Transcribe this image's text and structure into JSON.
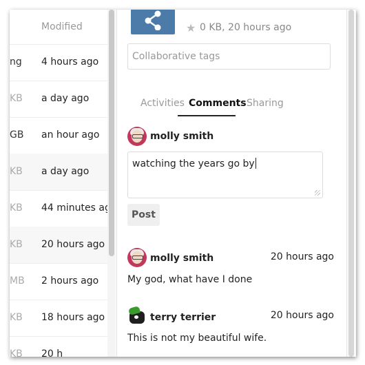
{
  "file_list": {
    "column_modified": "Modified",
    "rows": [
      {
        "size": "ng",
        "modified": "4 hours ago",
        "dark": true,
        "highlight": false
      },
      {
        "size": "KB",
        "modified": "a day ago",
        "dark": false,
        "highlight": false
      },
      {
        "size": "GB",
        "modified": "an hour ago",
        "dark": true,
        "highlight": false
      },
      {
        "size": "KB",
        "modified": "a day ago",
        "dark": false,
        "highlight": true
      },
      {
        "size": "KB",
        "modified": "44 minutes ag",
        "dark": false,
        "highlight": false
      },
      {
        "size": "KB",
        "modified": "20 hours ago",
        "dark": false,
        "highlight": true
      },
      {
        "size": "MB",
        "modified": "2 hours ago",
        "dark": false,
        "highlight": false
      },
      {
        "size": "KB",
        "modified": "18 hours ago",
        "dark": false,
        "highlight": false
      },
      {
        "size": "KB",
        "modified": "20 h",
        "dark": false,
        "highlight": false
      }
    ]
  },
  "sidebar": {
    "file_meta": "0 KB, 20 hours ago",
    "thumbnail_icon": "share-icon",
    "star_icon": "star-icon",
    "tags_placeholder": "Collaborative tags",
    "tabs": [
      {
        "label": "Activities",
        "active": false
      },
      {
        "label": "Comments",
        "active": true
      },
      {
        "label": "Sharing",
        "active": false
      }
    ],
    "composer": {
      "author": "molly smith",
      "text": "watching the years go by",
      "post_label": "Post"
    },
    "comments": [
      {
        "author": "molly smith",
        "time": "20 hours ago",
        "message": "My god, what have I done"
      },
      {
        "author": "terry terrier",
        "time": "20 hours ago",
        "message": "This is not my beautiful wife."
      }
    ]
  },
  "colors": {
    "thumbnail_bg": "#4d7ba9",
    "accent_avatar": "#c2385a"
  }
}
